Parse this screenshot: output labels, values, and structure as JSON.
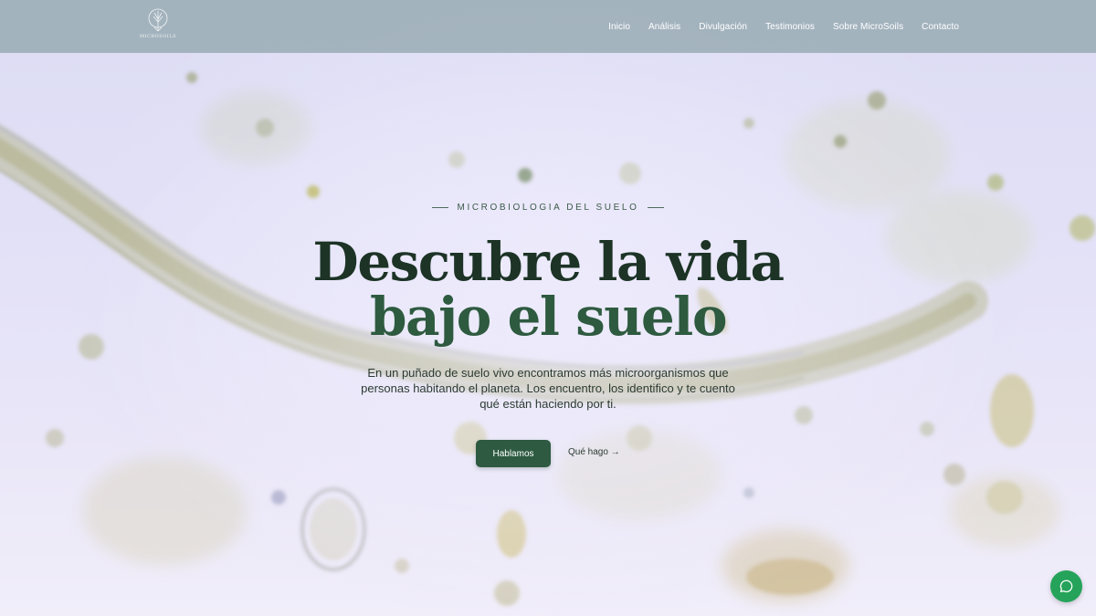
{
  "brand": {
    "logo_text": "MICROSOILS"
  },
  "nav": {
    "items": [
      "Inicio",
      "Análisis",
      "Divulgación",
      "Testimonios",
      "Sobre MicroSoils",
      "Contacto"
    ]
  },
  "hero": {
    "eyebrow": "MICROBIOLOGIA DEL SUELO",
    "title_line1": "Descubre la vida",
    "title_line2": "bajo el suelo",
    "lead": "En un puñado de suelo vivo encontramos más microorganismos que personas habitando el planeta. Los encuentro, los identifico y te cuento qué están haciendo por ti.",
    "cta_primary": "Hablamos",
    "cta_secondary": "Qué hago →"
  },
  "colors": {
    "header_bg": "#96aab2",
    "title_dark": "#1c3326",
    "title_green": "#2e5a40",
    "button_green": "#2d5a41",
    "chat_green": "#25a35a"
  },
  "icons": {
    "logo": "tree-icon",
    "chat": "whatsapp-icon"
  }
}
